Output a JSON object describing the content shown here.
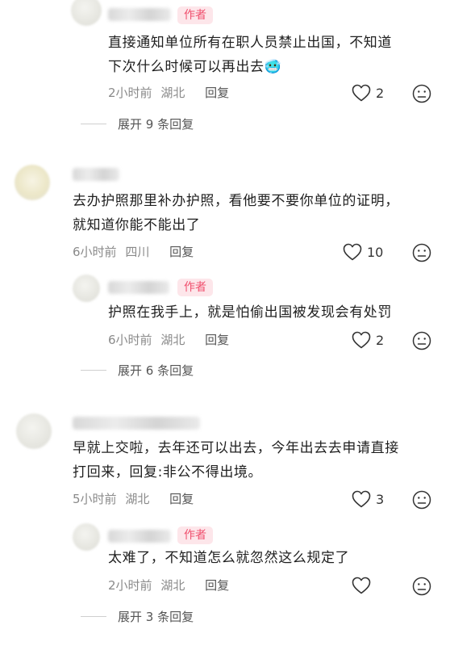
{
  "author_badge": "作者",
  "reply_label": "回复",
  "comments": [
    {
      "text_lines": [
        "直接通知单位所有在职人员禁止出国，不知道",
        "下次什么时候可以再出去🥶"
      ],
      "time": "2小时前",
      "location": "湖北",
      "likes": "2",
      "expand": "展开 9 条回复"
    },
    {
      "text_lines": [
        "去办护照那里补办护照，看他要不要你单位的证明，",
        "就知道你能不能出了"
      ],
      "time": "6小时前",
      "location": "四川",
      "likes": "10",
      "replies": [
        {
          "text_lines": [
            "护照在我手上，就是怕偷出国被发现会有处罚"
          ],
          "time": "6小时前",
          "location": "湖北",
          "likes": "2"
        }
      ],
      "expand": "展开 6 条回复"
    },
    {
      "text_lines": [
        "早就上交啦，去年还可以出去，今年出去去申请直接",
        "打回来，回复:非公不得出境。"
      ],
      "time": "5小时前",
      "location": "湖北",
      "likes": "3",
      "replies": [
        {
          "text_lines": [
            "太难了，不知道怎么就忽然这么规定了"
          ],
          "time": "2小时前",
          "location": "湖北",
          "likes": ""
        }
      ],
      "expand": "展开 3 条回复"
    }
  ]
}
